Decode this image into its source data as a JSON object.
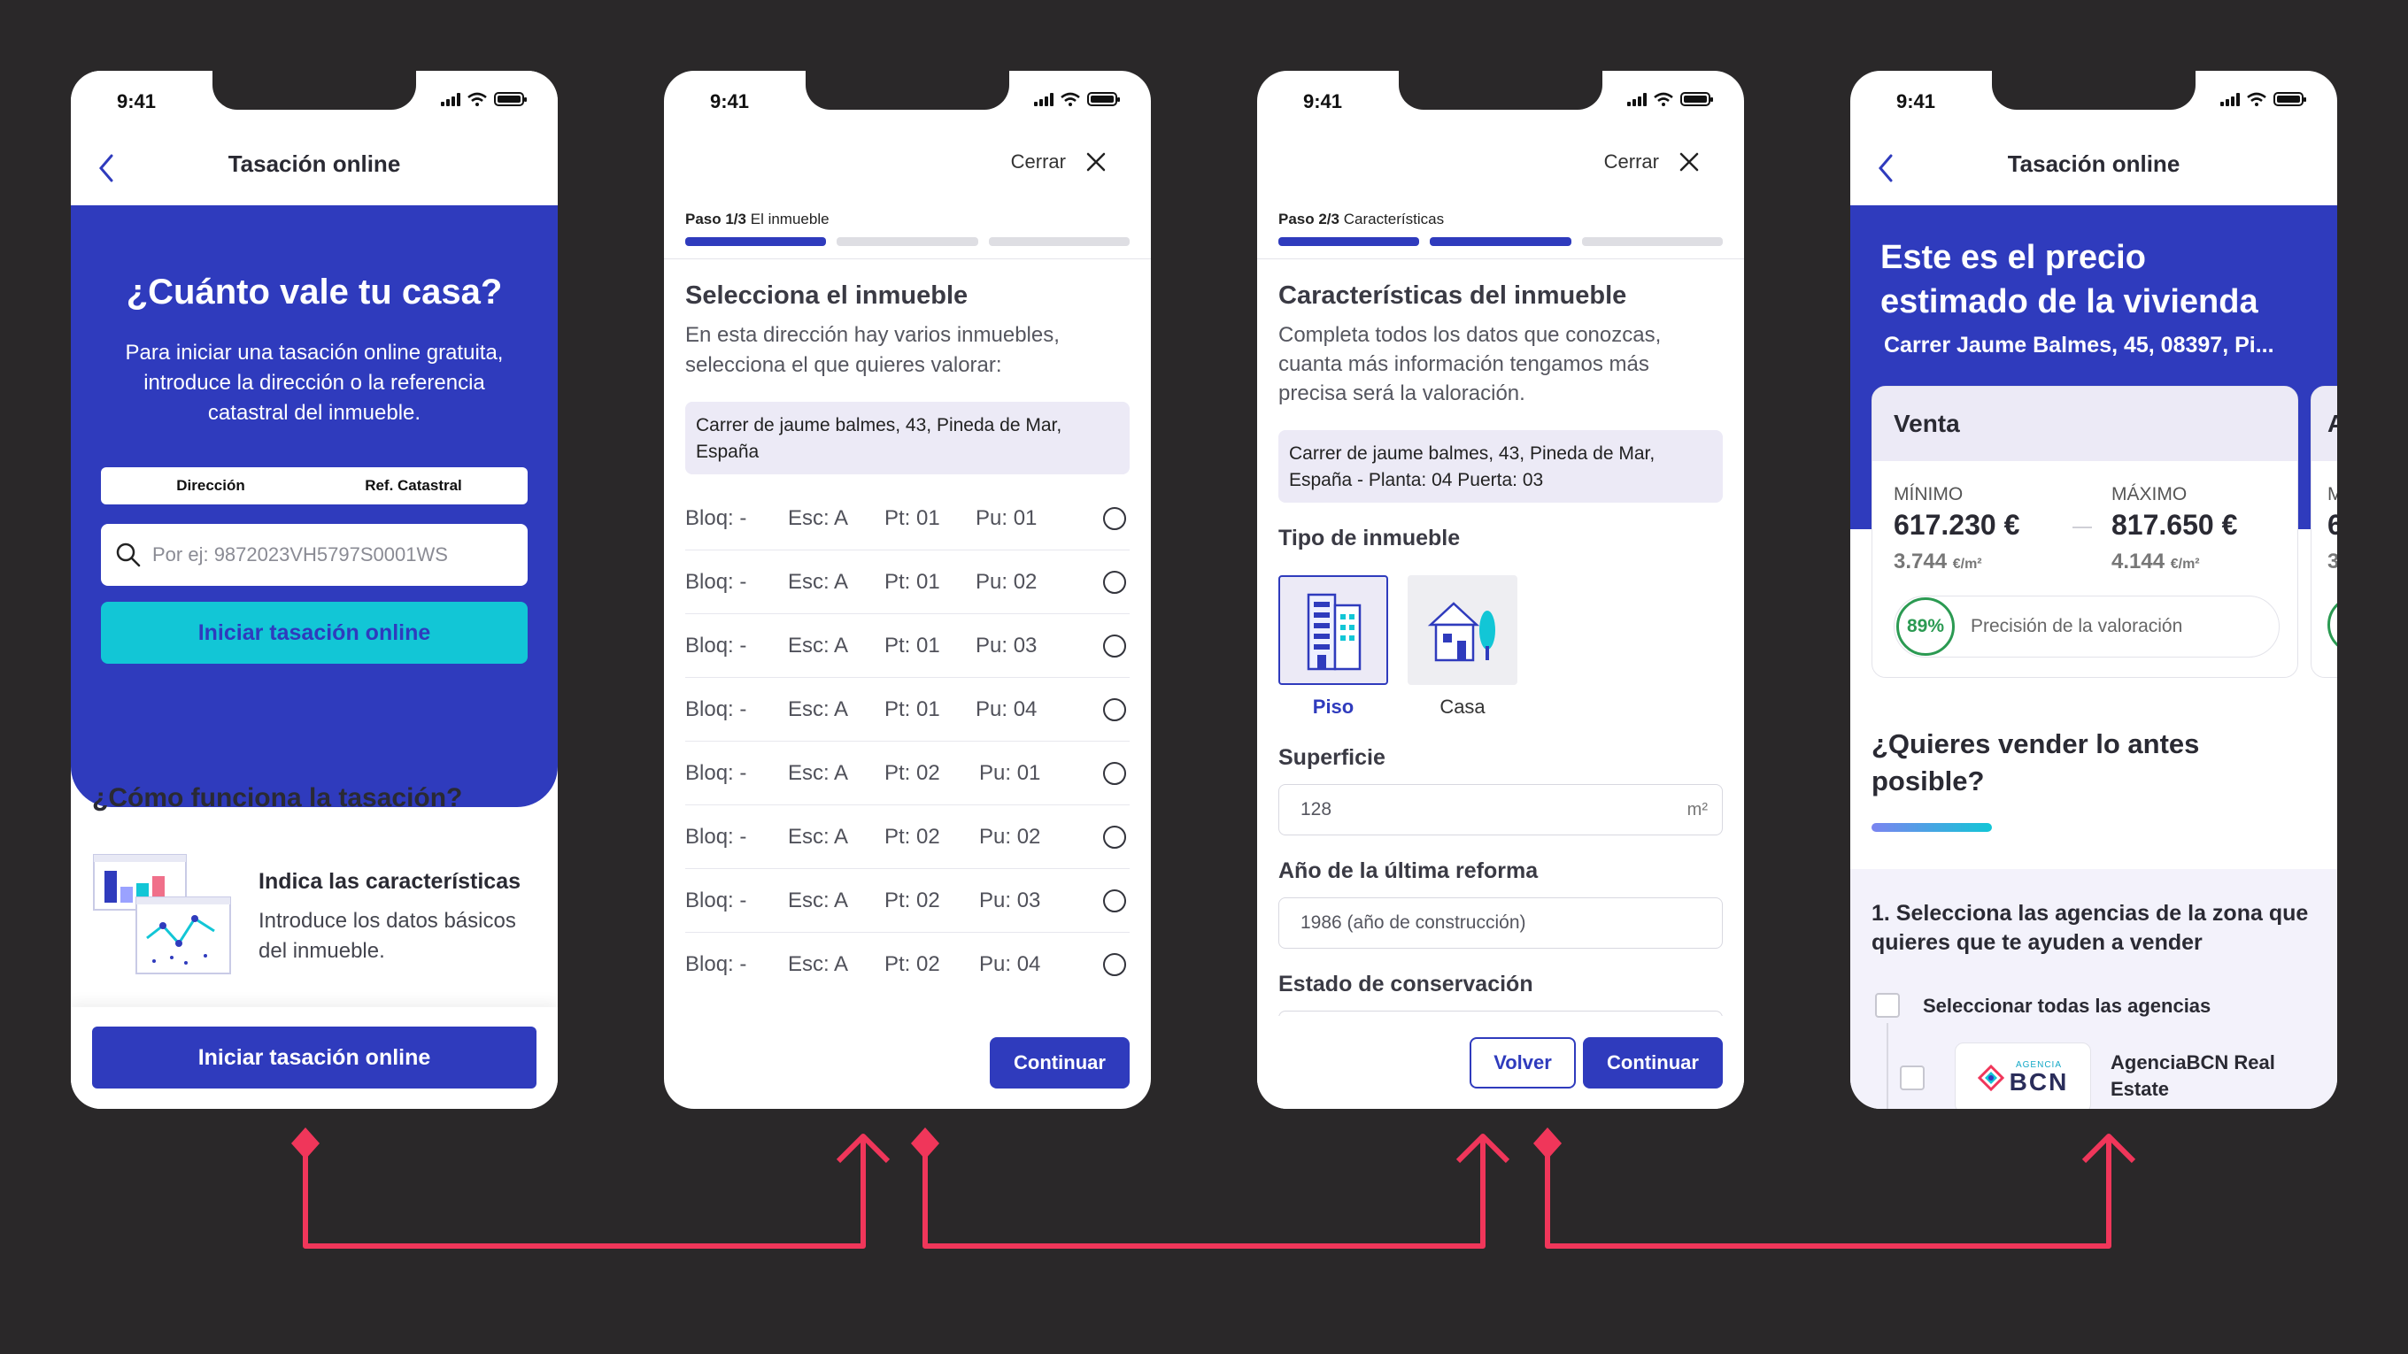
{
  "status": {
    "time": "9:41"
  },
  "screen1": {
    "header_title": "Tasación online",
    "hero_title": "¿Cuánto vale tu casa?",
    "hero_text": "Para iniciar una tasación online gratuita, introduce la dirección o la referencia catastral del inmueble.",
    "tab_address": "Dirección",
    "tab_cadastral": "Ref. Catastral",
    "search_placeholder": "Por ej: 9872023VH5797S0001WS",
    "start_button": "Iniciar tasación online",
    "how_title": "¿Cómo funciona la tasación?",
    "step_title": "Indica las características",
    "step_text": "Introduce los datos básicos del inmueble.",
    "bottom_button": "Iniciar tasación online"
  },
  "screen2": {
    "close_label": "Cerrar",
    "step_prefix": "Paso 1/3",
    "step_name": "El inmueble",
    "progress": {
      "current": 1,
      "total": 3
    },
    "title": "Selecciona el inmueble",
    "subtitle": "En esta dirección hay varios inmuebles, selecciona el que quieres valorar:",
    "address": "Carrer de jaume balmes, 43, Pineda de Mar, España",
    "units": [
      {
        "bloq": "Bloq: -",
        "esc": "Esc: A",
        "pt": "Pt: 01",
        "pu": "Pu: 01"
      },
      {
        "bloq": "Bloq: -",
        "esc": "Esc: A",
        "pt": "Pt: 01",
        "pu": "Pu: 02"
      },
      {
        "bloq": "Bloq: -",
        "esc": "Esc: A",
        "pt": "Pt: 01",
        "pu": "Pu: 03"
      },
      {
        "bloq": "Bloq: -",
        "esc": "Esc: A",
        "pt": "Pt: 01",
        "pu": "Pu: 04"
      },
      {
        "bloq": "Bloq: -",
        "esc": "Esc: A",
        "pt": "Pt: 02",
        "pu": "Pu: 01"
      },
      {
        "bloq": "Bloq: -",
        "esc": "Esc: A",
        "pt": "Pt: 02",
        "pu": "Pu: 02"
      },
      {
        "bloq": "Bloq: -",
        "esc": "Esc: A",
        "pt": "Pt: 02",
        "pu": "Pu: 03"
      },
      {
        "bloq": "Bloq: -",
        "esc": "Esc: A",
        "pt": "Pt: 02",
        "pu": "Pu: 04"
      }
    ],
    "continue_button": "Continuar"
  },
  "screen3": {
    "close_label": "Cerrar",
    "step_prefix": "Paso 2/3",
    "step_name": "Características",
    "progress": {
      "current": 2,
      "total": 3
    },
    "title": "Características del inmueble",
    "subtitle": "Completa todos los datos que conozcas, cuanta más información tengamos más precisa será la valoración.",
    "address": "Carrer de jaume balmes, 43, Pineda de Mar, España - Planta: 04 Puerta: 03",
    "type_label": "Tipo de inmueble",
    "type_options": [
      "Piso",
      "Casa"
    ],
    "area_label": "Superficie",
    "area_value": "128",
    "area_unit": "m²",
    "reform_label": "Año de la última reforma",
    "reform_value": "1986 (año de construcción)",
    "conservation_label": "Estado de conservación",
    "back_button": "Volver",
    "continue_button": "Continuar"
  },
  "screen4": {
    "header_title": "Tasación online",
    "hero_title": "Este es el precio estimado de la vivienda",
    "hero_address": "Carrer Jaume Balmes, 45, 08397, Pi...",
    "card_title": "Venta",
    "min_label": "MÍNIMO",
    "min_value": "617.230 €",
    "min_sqm": "3.744",
    "max_label": "MÁXIMO",
    "max_value": "817.650 €",
    "max_sqm": "4.144",
    "sqm_unit": "€/m²",
    "precision_value": "89%",
    "precision_label": "Precisión de la valoración",
    "next_card_title_partial": "A",
    "next_card_min_partial": "M",
    "next_card_value_partial": "6",
    "next_card_sqm_partial": "3",
    "sell_title": "¿Quieres vender lo antes posible?",
    "agencies_title": "1. Selecciona las agencias de la zona que quieres que te ayuden a vender",
    "select_all": "Seleccionar todas las agencias",
    "agency_name": "AgenciaBCN Real Estate",
    "agency_logo_top": "AGENCIA",
    "agency_logo_main": "BCN"
  },
  "colors": {
    "primary": "#2f3bbd",
    "accent": "#12c6d6",
    "arrow": "#f0365a",
    "background": "#2a2829",
    "success": "#2b9a52"
  }
}
